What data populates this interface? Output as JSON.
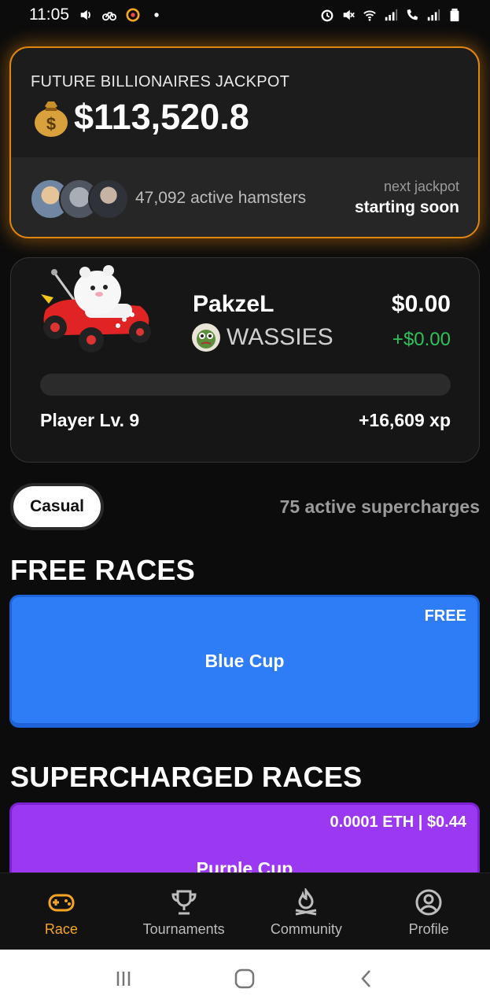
{
  "status_bar": {
    "time": "11:05"
  },
  "jackpot": {
    "title": "FUTURE BILLIONAIRES JACKPOT",
    "amount": "$113,520.8",
    "active_text": "47,092 active hamsters",
    "next_label": "next jackpot",
    "next_status": "starting soon",
    "accent_color": "#e0860f"
  },
  "player": {
    "name": "PakzeL",
    "team": "WASSIES",
    "balance": "$0.00",
    "delta": "+$0.00",
    "level": "Player Lv. 9",
    "xp": "+16,609 xp",
    "xp_progress": 0
  },
  "mode": {
    "selected": "Casual",
    "supercharges": "75 active supercharges"
  },
  "sections": {
    "free_title": "FREE RACES",
    "supercharged_title": "SUPERCHARGED RACES"
  },
  "races": {
    "blue": {
      "tag": "FREE",
      "name": "Blue Cup",
      "color": "#2f7df6"
    },
    "purple": {
      "tag": "0.0001 ETH | $0.44",
      "name": "Purple Cup",
      "color": "#9b38f2"
    }
  },
  "nav": {
    "items": [
      {
        "label": "Race",
        "icon": "gamepad-icon",
        "active": true
      },
      {
        "label": "Tournaments",
        "icon": "trophy-icon"
      },
      {
        "label": "Community",
        "icon": "campfire-icon"
      },
      {
        "label": "Profile",
        "icon": "user-icon"
      }
    ],
    "active_color": "#f5a524"
  }
}
